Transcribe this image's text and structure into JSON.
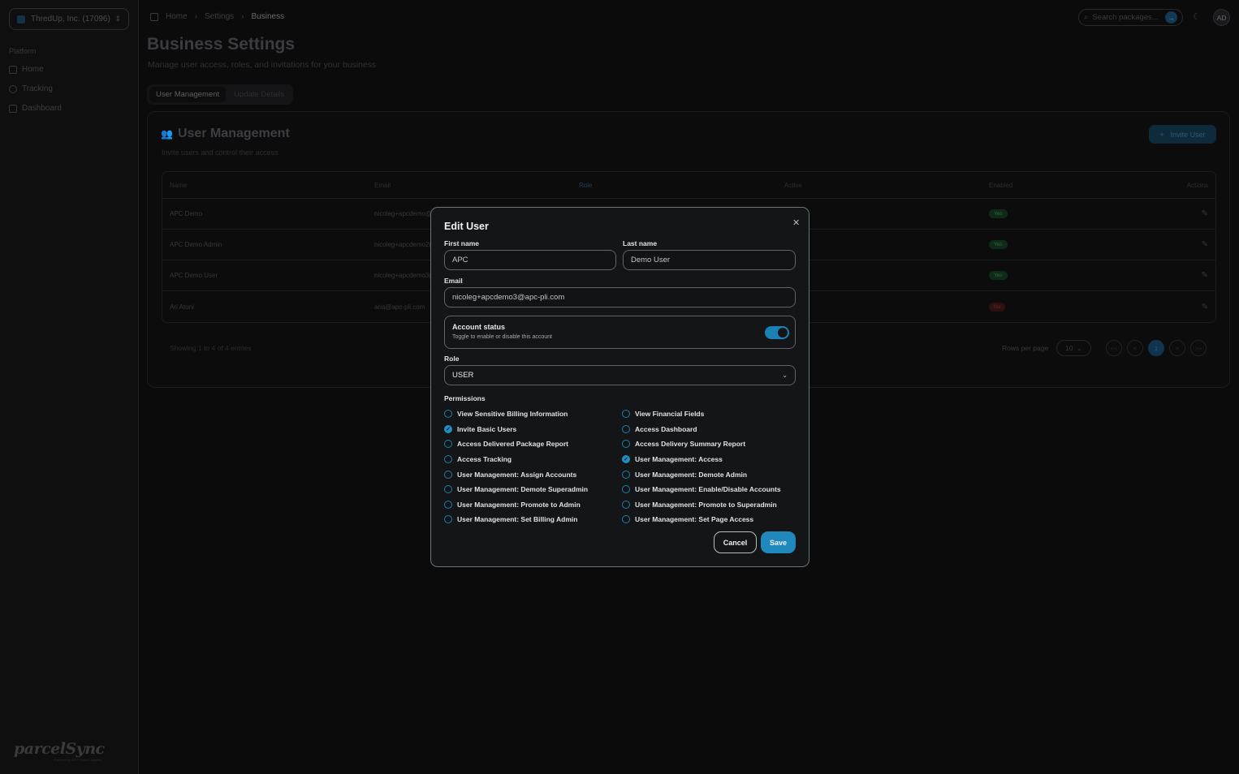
{
  "sidebar": {
    "org": "ThredUp, Inc. (17096)",
    "section_label": "Platform",
    "items": [
      {
        "label": "Home",
        "icon": "grid-icon"
      },
      {
        "label": "Tracking",
        "icon": "package-icon"
      },
      {
        "label": "Dashboard",
        "icon": "document-icon"
      }
    ],
    "logo": "parcelSync",
    "logo_sub": "Powered by APC Postal Logistics"
  },
  "header": {
    "breadcrumbs": [
      "Home",
      "Settings",
      "Business"
    ],
    "search_placeholder": "Search packages...",
    "avatar": "AD"
  },
  "page": {
    "title": "Business Settings",
    "subtitle": "Manage user access, roles, and invitations for your business",
    "tabs": [
      "User Management",
      "Update Details"
    ]
  },
  "card": {
    "title": "User Management",
    "subtitle": "Invite users and control their access",
    "invite_button": "Invite User",
    "columns": [
      "Name",
      "Email",
      "Role",
      "Active",
      "Enabled",
      "Actions"
    ],
    "rows": [
      {
        "name": "APC Demo",
        "email": "nicoleg+apcdemo@",
        "enabled": "Yes"
      },
      {
        "name": "APC Demo Admin",
        "email": "nicoleg+apcdemo2(",
        "enabled": "Yes"
      },
      {
        "name": "APC Demo User",
        "email": "nicoleg+apcdemo3(",
        "enabled": "Yes"
      },
      {
        "name": "Ari Atoni",
        "email": "aria@apc-pli.com",
        "enabled": "No"
      }
    ],
    "showing": "Showing 1 to 4 of 4 entries",
    "rows_per_page_label": "Rows per page",
    "rows_per_page": "10",
    "pager": [
      "<<",
      "<",
      "1",
      ">",
      ">>"
    ]
  },
  "modal": {
    "title": "Edit User",
    "first_name_label": "First name",
    "first_name": "APC",
    "last_name_label": "Last name",
    "last_name": "Demo User",
    "email_label": "Email",
    "email": "nicoleg+apcdemo3@apc-pli.com",
    "status_title": "Account status",
    "status_sub": "Toggle to enable or disable this account",
    "status_on": true,
    "role_label": "Role",
    "role": "USER",
    "permissions_label": "Permissions",
    "permissions": [
      {
        "label": "View Sensitive Billing Information",
        "checked": false
      },
      {
        "label": "View Financial Fields",
        "checked": false
      },
      {
        "label": "Invite Basic Users",
        "checked": true
      },
      {
        "label": "Access Dashboard",
        "checked": false
      },
      {
        "label": "Access Delivered Package Report",
        "checked": false
      },
      {
        "label": "Access Delivery Summary Report",
        "checked": false
      },
      {
        "label": "Access Tracking",
        "checked": false
      },
      {
        "label": "User Management: Access",
        "checked": true
      },
      {
        "label": "User Management: Assign Accounts",
        "checked": false
      },
      {
        "label": "User Management: Demote Admin",
        "checked": false
      },
      {
        "label": "User Management: Demote Superadmin",
        "checked": false
      },
      {
        "label": "User Management: Enable/Disable Accounts",
        "checked": false
      },
      {
        "label": "User Management: Promote to Admin",
        "checked": false
      },
      {
        "label": "User Management: Promote to Superadmin",
        "checked": false
      },
      {
        "label": "User Management: Set Billing Admin",
        "checked": false
      },
      {
        "label": "User Management: Set Page Access",
        "checked": false
      }
    ],
    "cancel": "Cancel",
    "save": "Save"
  }
}
